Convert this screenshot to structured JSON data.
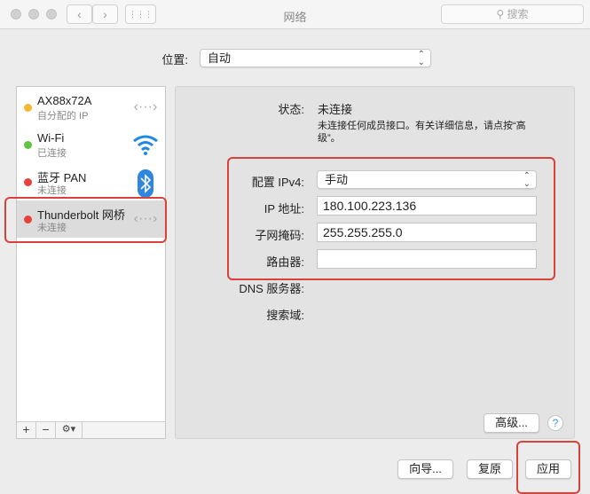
{
  "window": {
    "title": "网络",
    "search_placeholder": "搜索",
    "back": "‹",
    "forward": "›",
    "grid": "⋮⋮⋮"
  },
  "location": {
    "label": "位置:",
    "value": "自动"
  },
  "services": [
    {
      "name": "AX88x72A",
      "status": "自分配的 IP",
      "dot_color": "#f5b82e",
      "icon": "ethernet-icon"
    },
    {
      "name": "Wi-Fi",
      "status": "已连接",
      "dot_color": "#5fc63f",
      "icon": "wifi-icon"
    },
    {
      "name": "蓝牙 PAN",
      "status": "未连接",
      "dot_color": "#e8413a",
      "icon": "bluetooth-icon"
    },
    {
      "name": "Thunderbolt 网桥",
      "status": "未连接",
      "dot_color": "#e8413a",
      "icon": "ethernet-icon"
    }
  ],
  "sidebar_buttons": {
    "add": "+",
    "remove": "−",
    "action": "⚙▾"
  },
  "detail": {
    "status_label": "状态:",
    "status_value": "未连接",
    "status_desc": "未连接任何成员接口。有关详细信息，请点按“高级”。",
    "ipv4_label": "配置 IPv4:",
    "ipv4_value": "手动",
    "ip_label": "IP 地址:",
    "ip_value": "180.100.223.136",
    "mask_label": "子网掩码:",
    "mask_value": "255.255.255.0",
    "router_label": "路由器:",
    "router_value": "",
    "dns_label": "DNS 服务器:",
    "search_label": "搜索域:"
  },
  "buttons": {
    "advanced": "高级...",
    "help": "?",
    "assist": "向导...",
    "revert": "复原",
    "apply": "应用"
  }
}
